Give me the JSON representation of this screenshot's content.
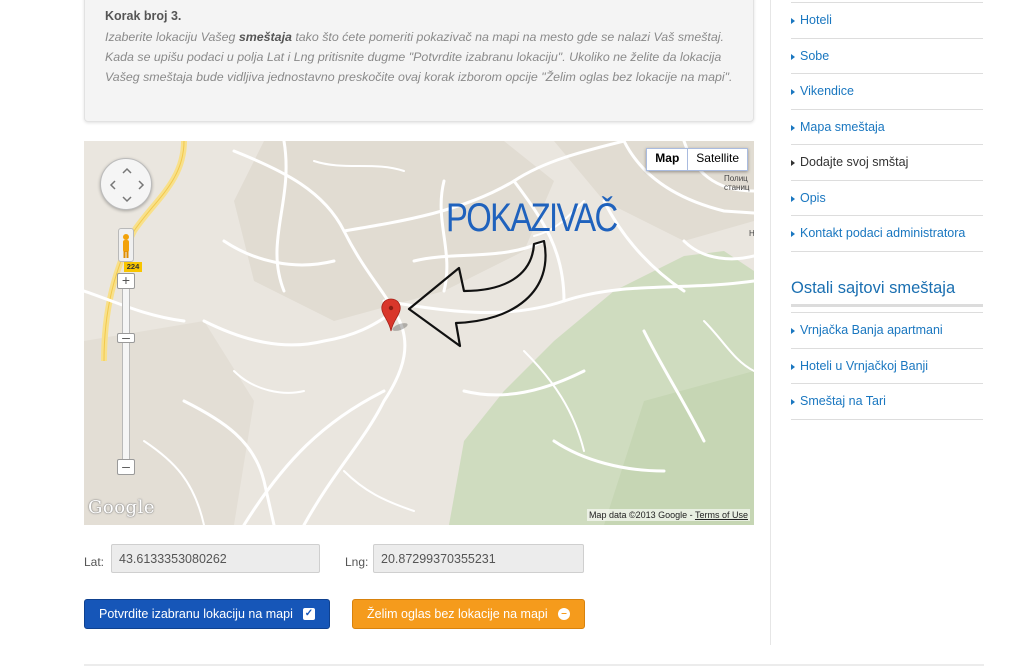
{
  "step": {
    "title": "Korak broj 3.",
    "text_before": "Izaberite lokaciju Vašeg ",
    "text_bold": "smeštaja",
    "text_after": " tako što ćete pomeriti pokazivač na mapi na mesto gde se nalazi Vaš smeštaj. Kada se upišu podaci u polja Lat i Lng pritisnite dugme \"Potvrdite izabranu lokaciju\". Ukoliko ne želite da lokacija Vašeg smeštaja bude vidljiva jednostavno preskočite ovaj korak izborom opcije \"Želim oglas bez lokacije na mapi\"."
  },
  "map": {
    "type_map": "Map",
    "type_satellite": "Satellite",
    "road_number": "224",
    "poi_label_1": "Полиц",
    "poi_label_2": "станиц",
    "poi_label_3": "Н",
    "google_logo": "Google",
    "attribution": "Map data ©2013 Google - ",
    "terms": "Terms of Use",
    "annotation": "POKAZIVAČ",
    "marker_color": "#d9372b"
  },
  "form": {
    "lat_label": "Lat:",
    "lat_value": "43.6133353080262",
    "lng_label": "Lng:",
    "lng_value": "20.87299370355231",
    "confirm_label": "Potvrdite izabranu lokaciju na mapi",
    "skip_label": "Želim oglas bez lokacije na mapi"
  },
  "sidebar": {
    "menu": [
      {
        "label": "Hoteli"
      },
      {
        "label": "Sobe"
      },
      {
        "label": "Vikendice"
      },
      {
        "label": "Mapa smeštaja"
      },
      {
        "label": "Dodajte svoj smštaj"
      },
      {
        "label": "Opis"
      },
      {
        "label": "Kontakt podaci administratora"
      }
    ],
    "heading": "Ostali sajtovi smeštaja",
    "links": [
      {
        "label": "Vrnjačka Banja apartmani"
      },
      {
        "label": "Hoteli u Vrnjačkoj Banji"
      },
      {
        "label": "Smeštaj na Tari"
      }
    ]
  },
  "colors": {
    "link": "#1a77c0",
    "confirm_button": "#1656b8",
    "skip_button": "#f59b1c",
    "annotation": "#1f62bd"
  }
}
